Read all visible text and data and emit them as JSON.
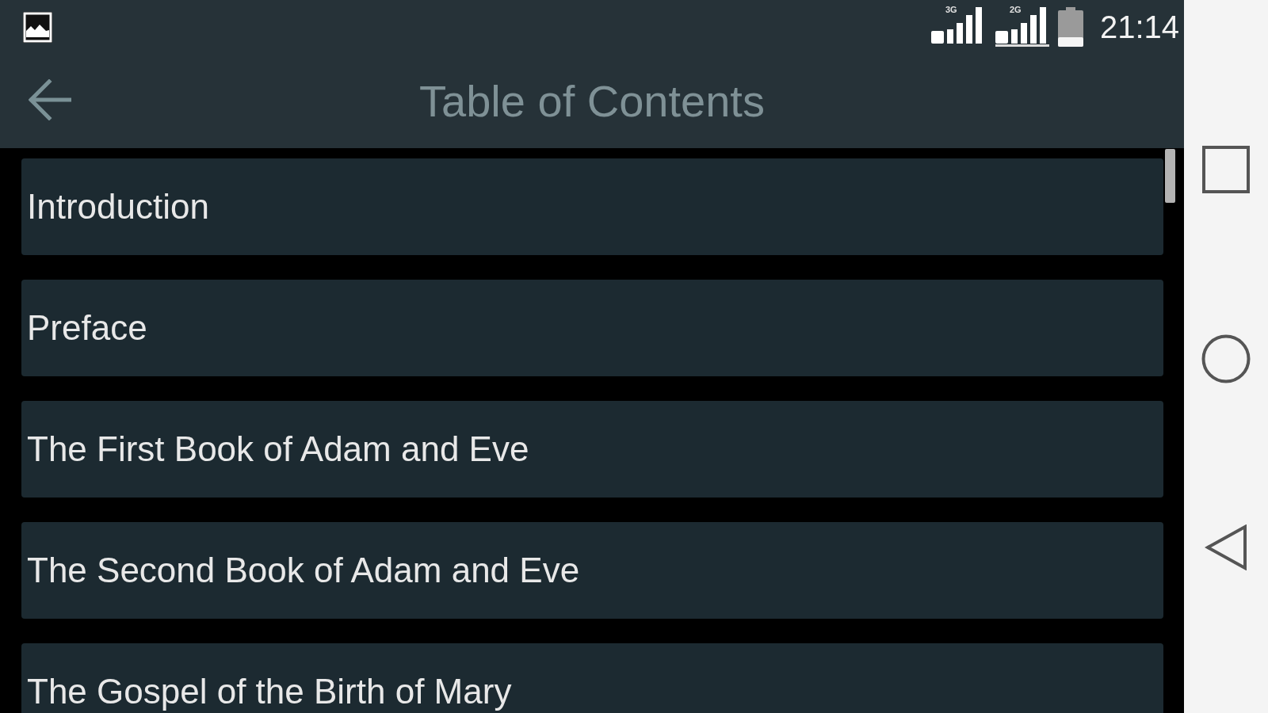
{
  "status_bar": {
    "networks": [
      {
        "type": "3G"
      },
      {
        "type": "2G"
      }
    ],
    "time": "21:14"
  },
  "toolbar": {
    "title": "Table of Contents"
  },
  "contents": {
    "items": [
      {
        "title": "Introduction"
      },
      {
        "title": "Preface"
      },
      {
        "title": "The First Book of Adam and Eve"
      },
      {
        "title": "The Second Book of Adam and Eve"
      },
      {
        "title": "The Gospel of the Birth of Mary"
      }
    ]
  }
}
